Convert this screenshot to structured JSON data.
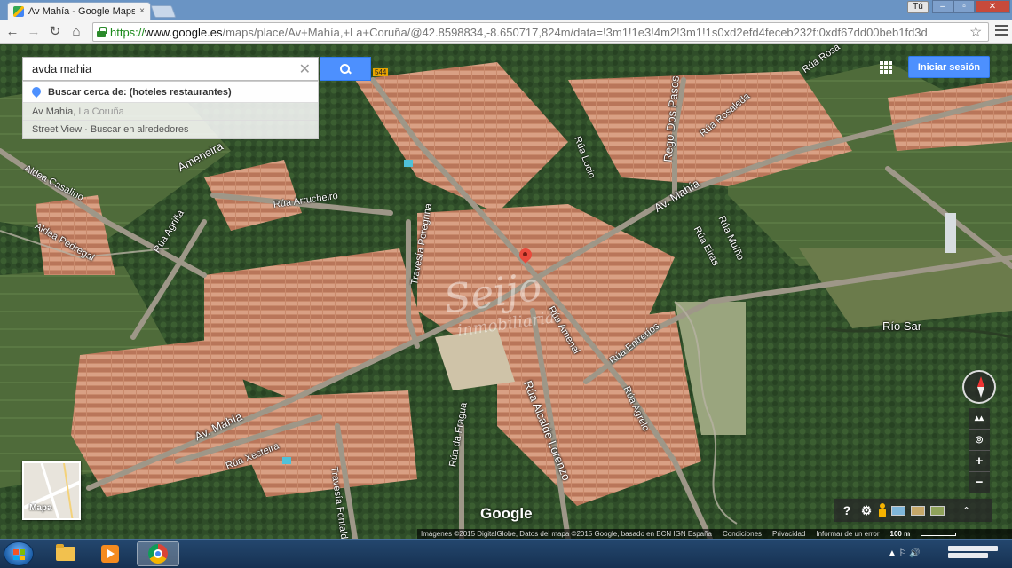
{
  "browser": {
    "tab_title": "Av Mahía - Google Maps",
    "tab_close": "×",
    "user_badge": "Tú",
    "win_min": "–",
    "win_max": "▫",
    "win_close": "✕",
    "url_scheme": "https://",
    "url_host": "www.google.es",
    "url_path": "/maps/place/Av+Mahía,+La+Coruña/@42.8598834,-8.650717,824m/data=!3m1!1e3!4m2!3m1!1s0xd2efd4feceb232f:0xdf67dd00beb1fd3d",
    "back": "←",
    "forward": "→",
    "reload": "↻",
    "home": "⌂",
    "star": "☆"
  },
  "search": {
    "value": "avda mahia",
    "clear": "✕",
    "suggestions": [
      {
        "main": "Buscar cerca de: (hoteles restaurantes)"
      },
      {
        "main": "Av Mahía,",
        "muted": "La Coruña"
      },
      {
        "main": "Street View · Buscar en alrededores"
      }
    ]
  },
  "header": {
    "signin": "Iniciar sesión"
  },
  "map": {
    "labels": {
      "ameneira": "Ameneira",
      "aldea_casalino": "Aldea Casalino",
      "aldea_pedregal": "Aldea Pedregal",
      "rua_agrina": "Rúa Agriña",
      "rua_arrucheiro": "Rúa Arrucheiro",
      "travesia_peregrina": "Travesía Peregrina",
      "rua_locio": "Rúa Locio",
      "rego_dos_pasos": "Rego Dos Pasos",
      "rua_rosaleda": "Rúa Rosaleda",
      "rua_rosa": "Rúa Rosa",
      "av_mahia_upper": "Av. Mahía",
      "rua_muino": "Rúa Muíño",
      "rua_eiras": "Rúa Eiras",
      "rio_sar": "Río Sar",
      "rua_amenal": "Rúa Amenal",
      "rua_entrerios": "Rúa Entreríos",
      "rua_alcalde_lorenzo": "Rúa Alcalde Lorenzo",
      "rua_agrelo": "Rúa Agrelo",
      "av_mahia_lower": "Av. Mahía",
      "rua_xesteira": "Rúa Xesteira",
      "travesia_fontaldeiro": "Travesía Fontaldeiro",
      "rua_da_fragua": "Rúa da Fragua",
      "road_badge": "544"
    },
    "watermark_main": "Seijo",
    "watermark_sub": "inmobiliaria",
    "minimap_label": "Mapa",
    "google_logo": "Google",
    "controls": {
      "zoom_in": "+",
      "zoom_out": "−",
      "help": "?",
      "settings": "⚙",
      "expand": "⌃"
    },
    "footer": {
      "attribution": "Imágenes ©2015 DigitalGlobe, Datos del mapa ©2015 Google, basado en BCN IGN España",
      "terms": "Condiciones",
      "privacy": "Privacidad",
      "report": "Informar de un error",
      "scale": "100 m"
    }
  },
  "taskbar": {
    "tray_icons": "▲ ⚐ 🔊"
  }
}
